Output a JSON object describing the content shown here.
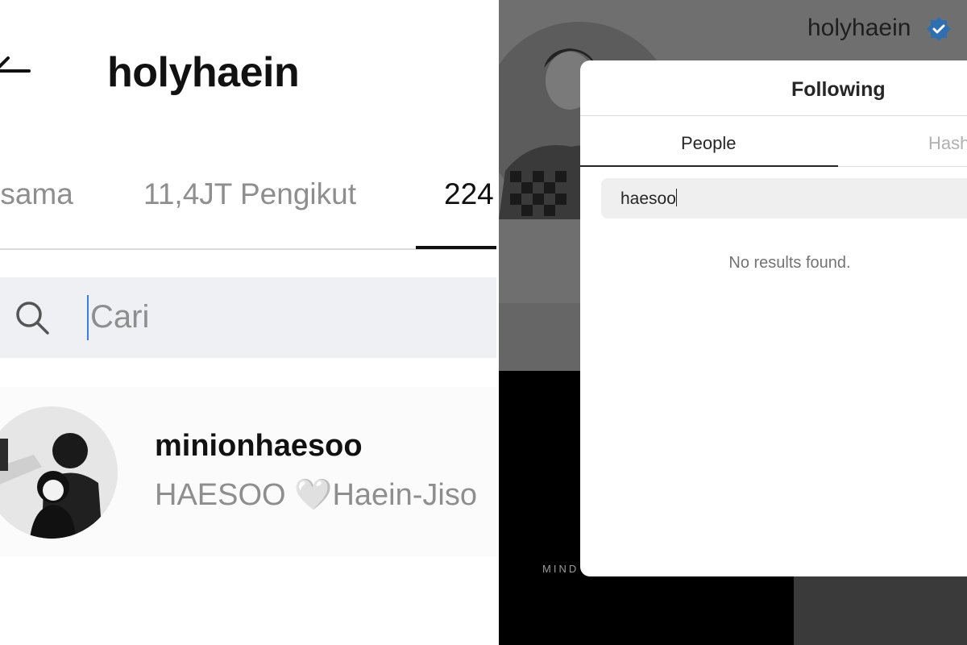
{
  "left_panel": {
    "title": "holyhaein",
    "tabs": {
      "mutual": "rsama",
      "followers": "11,4JT Pengikut",
      "following": "224"
    },
    "search": {
      "placeholder": "Cari"
    },
    "result": {
      "username": "minionhaesoo",
      "fullname": "HAESOO 🤍Haein-Jiso"
    }
  },
  "right_panel": {
    "profile_username": "holyhaein",
    "grid_caption": "MIND",
    "modal": {
      "title": "Following",
      "tabs": {
        "people": "People",
        "hashtags": "Hash"
      },
      "search_value": "haesoo",
      "empty_message": "No results found."
    }
  },
  "colors": {
    "verified": "#3897f0",
    "accent_caret": "#3d7be0",
    "overlay": "#6f6f6f"
  },
  "icons": [
    "back-arrow-icon",
    "search-icon",
    "verified-badge-icon"
  ]
}
